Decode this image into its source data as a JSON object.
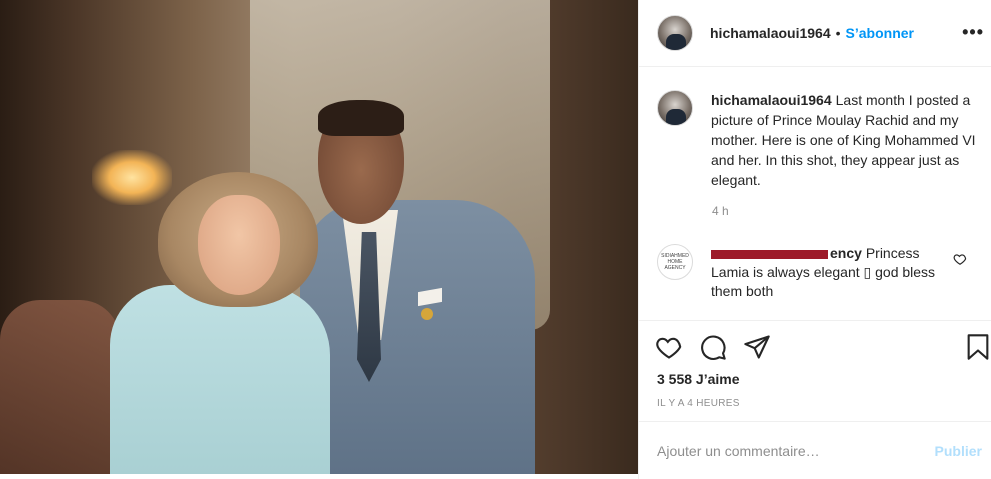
{
  "header": {
    "username": "hichamalaoui1964",
    "separator": "•",
    "follow_label": "S’abonner",
    "more_label": "•••"
  },
  "caption": {
    "username": "hichamalaoui1964",
    "text": "Last month I posted a picture of Prince Moulay Rachid and my mother. Here is one of King Mohammed VI and her. In this shot, they appear just as elegant.",
    "time": "4 h"
  },
  "comment": {
    "username_visible_tail": "ency",
    "text": "Princess Lamia is always elegant ▯ god bless them both",
    "avatar_text": "SIDIAHMED HOME AGENCY"
  },
  "actions": {
    "like_icon": "heart-outline-icon",
    "comment_icon": "comment-bubble-icon",
    "share_icon": "paper-plane-icon",
    "save_icon": "bookmark-icon"
  },
  "likes": "3 558 J’aime",
  "posted_ago": "IL Y A 4 HEURES",
  "add_comment": {
    "placeholder": "Ajouter un commentaire…",
    "publish_label": "Publier"
  },
  "colors": {
    "accent": "#0095f6",
    "publish_disabled": "#b2dffc",
    "redaction": "#9d1a29",
    "muted_text": "#8e8e8e"
  }
}
